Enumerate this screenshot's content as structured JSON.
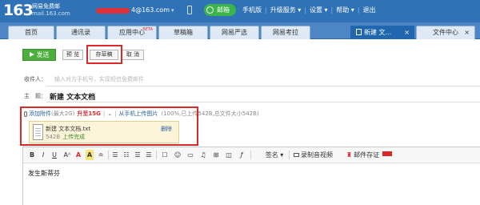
{
  "header": {
    "logo": "163",
    "logo_title": "网易免费邮",
    "logo_domain": "mail.163.com",
    "account": "4@163.com",
    "vip_label": "邮箱",
    "nav": [
      "手机版",
      "升级服务 ▾",
      "设置 ▾",
      "帮助 ▾",
      "退出"
    ]
  },
  "tabs": [
    {
      "label": "首页"
    },
    {
      "label": "通讯录"
    },
    {
      "label": "应用中心",
      "badge": "BETA"
    },
    {
      "label": "草稿箱"
    },
    {
      "label": "网易严选"
    },
    {
      "label": "网易考拉"
    },
    {
      "label": "新建 文...",
      "close": "×"
    },
    {
      "label": "文件中心",
      "close": "×"
    }
  ],
  "toolbar": {
    "send": "发送",
    "preview": "预 览",
    "save_draft": "存草稿",
    "cancel": "取 消"
  },
  "compose": {
    "to_label": "收件人：",
    "to_placeholder": "输入对方手机号，实现短信免费邮件",
    "subject_label": "主　题：",
    "subject_value": "新建 文本文档"
  },
  "attachment": {
    "add_label": "添加附件",
    "max_label": "(最大2G)",
    "upgrade_label": "升至15G",
    "phone_upload": "从手机上传图片",
    "summary": "(100%,已上传542B,总文件大小542B)",
    "file_name": "新建 文本文档.txt",
    "file_size": "542B",
    "file_status": "上传完成",
    "delete": "删除"
  },
  "editor": {
    "tools": [
      "B",
      "I",
      "U",
      "Aᴬ",
      "A",
      "A",
      "≐",
      "☰",
      "☷",
      "☰",
      "☰",
      "☐",
      "☺",
      "▭",
      "♫",
      "⊞",
      "◫",
      "ƒ",
      "签名 ▾",
      "录制音视频",
      "邮件存证"
    ],
    "body": "发生斯蒂芬"
  },
  "colors": {
    "header_bg": "#2f72b5",
    "tab_bg": "#4e86c5",
    "send_green": "#4cae3c",
    "highlight_red": "#d9292b",
    "attach_bg": "#fcf4d9"
  }
}
